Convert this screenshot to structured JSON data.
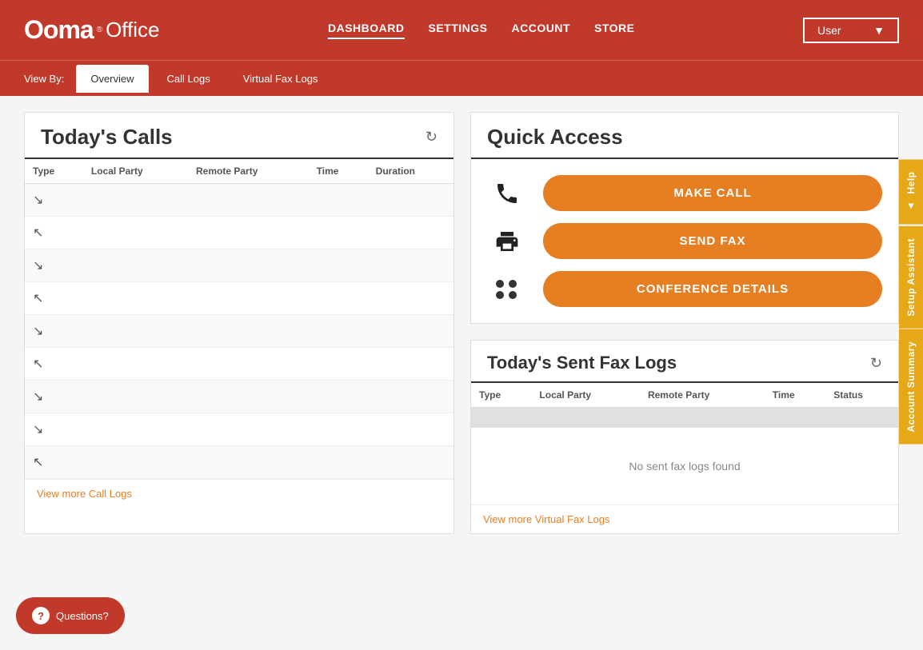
{
  "header": {
    "logo_main": "Ooma",
    "logo_office": "Office",
    "nav_items": [
      {
        "label": "DASHBOARD",
        "active": true
      },
      {
        "label": "SETTINGS",
        "active": false
      },
      {
        "label": "ACCOUNT",
        "active": false
      },
      {
        "label": "STORE",
        "active": false
      }
    ],
    "user_label": "User"
  },
  "sub_nav": {
    "view_by_label": "View By:",
    "tabs": [
      {
        "label": "Overview",
        "active": true
      },
      {
        "label": "Call Logs",
        "active": false
      },
      {
        "label": "Virtual Fax Logs",
        "active": false
      }
    ]
  },
  "todays_calls": {
    "title": "Today's Calls",
    "columns": [
      "Type",
      "Local Party",
      "Remote Party",
      "Time",
      "Duration"
    ],
    "rows": [
      {
        "type": "down"
      },
      {
        "type": "up"
      },
      {
        "type": "down"
      },
      {
        "type": "up"
      },
      {
        "type": "down"
      },
      {
        "type": "up"
      },
      {
        "type": "down"
      },
      {
        "type": "down"
      },
      {
        "type": "up"
      }
    ],
    "view_more_label": "View more Call Logs"
  },
  "quick_access": {
    "title": "Quick Access",
    "items": [
      {
        "icon": "phone",
        "button_label": "MAKE CALL"
      },
      {
        "icon": "fax",
        "button_label": "SEND FAX"
      },
      {
        "icon": "conference",
        "button_label": "CONFERENCE DETAILS"
      }
    ]
  },
  "todays_fax_logs": {
    "title": "Today's Sent Fax Logs",
    "columns": [
      "Type",
      "Local Party",
      "Remote Party",
      "Time",
      "Status"
    ],
    "empty_message": "No sent fax logs found",
    "view_more_label": "View more Virtual Fax Logs"
  },
  "side_tabs": [
    {
      "label": "Help",
      "arrow": "▲"
    },
    {
      "label": "Setup Assistant"
    },
    {
      "label": "Account Summary"
    }
  ],
  "questions_button": {
    "label": "Questions?"
  }
}
